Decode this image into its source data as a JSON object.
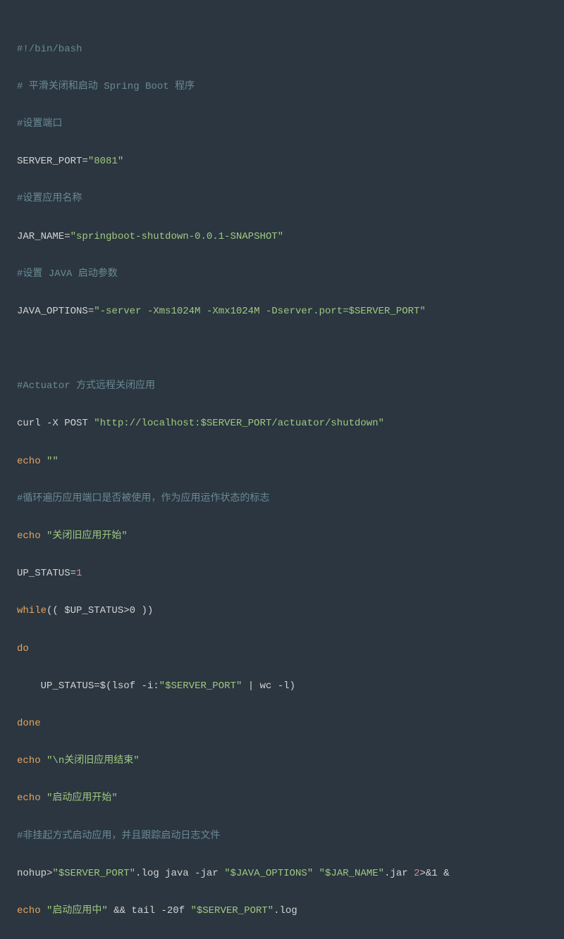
{
  "lines": {
    "l1_shebang": "#!/bin/bash",
    "l2_comment": "# 平滑关闭和启动 Spring Boot 程序",
    "l3_comment": "#设置端口",
    "l4_var": "SERVER_PORT",
    "l4_eq": "=",
    "l4_val": "\"8081\"",
    "l5_comment": "#设置应用名称",
    "l6_var": "JAR_NAME",
    "l6_eq": "=",
    "l6_val": "\"springboot-shutdown-0.0.1-SNAPSHOT\"",
    "l7_comment": "#设置 JAVA 启动参数",
    "l8_var": "JAVA_OPTIONS",
    "l8_eq": "=",
    "l8_val": "\"-server -Xms1024M -Xmx1024M -Dserver.port=$SERVER_PORT\"",
    "l10_comment": "#Actuator 方式远程关闭应用",
    "l11_curl": "curl -X POST ",
    "l11_url": "\"http://localhost:$SERVER_PORT/actuator/shutdown\"",
    "l12_echo": "echo ",
    "l12_str": "\"\"",
    "l13_comment": "#循环遍历应用端口是否被使用，作为应用运作状态的标志",
    "l14_echo": "echo ",
    "l14_str": "\"关闭旧应用开始\"",
    "l15_var": "UP_STATUS",
    "l15_eq": "=",
    "l15_val": "1",
    "l16_while": "while",
    "l16_cond": "(( $UP_STATUS>0 ))",
    "l17_do": "do",
    "l18_indent": "    ",
    "l18_var": "UP_STATUS",
    "l18_eq": "=",
    "l18_expr_open": "$(",
    "l18_lsof": "lsof -i:",
    "l18_port": "\"$SERVER_PORT\"",
    "l18_pipe": " | wc -l)",
    "l19_done": "done",
    "l20_echo": "echo ",
    "l20_str": "\"\\n关闭旧应用结束\"",
    "l21_echo": "echo ",
    "l21_str": "\"启动应用开始\"",
    "l22_comment": "#非挂起方式启动应用，并且跟踪启动日志文件",
    "l23_nohup": "nohup>",
    "l23_port": "\"$SERVER_PORT\"",
    "l23_log": ".log java -jar ",
    "l23_opts": "\"$JAVA_OPTIONS\"",
    "l23_sp": " ",
    "l23_jar": "\"$JAR_NAME\"",
    "l23_rest": ".jar ",
    "l23_two": "2",
    "l23_redir": ">&1 &",
    "l24_echo": "echo ",
    "l24_str": "\"启动应用中\"",
    "l24_and": " && tail -20f ",
    "l24_port": "\"$SERVER_PORT\"",
    "l24_log": ".log"
  }
}
